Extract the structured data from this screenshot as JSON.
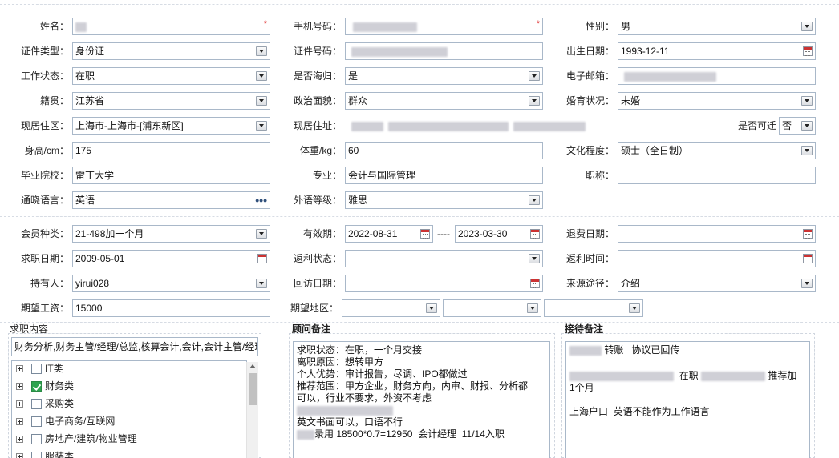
{
  "form": {
    "name_label": "姓名：",
    "phone_label": "手机号码：",
    "gender_label": "性别：",
    "gender_value": "男",
    "id_type_label": "证件类型：",
    "id_type_value": "身份证",
    "id_no_label": "证件号码：",
    "birth_label": "出生日期：",
    "birth_value": "1993-12-11",
    "work_status_label": "工作状态：",
    "work_status_value": "在职",
    "overseas_label": "是否海归：",
    "overseas_value": "是",
    "email_label": "电子邮箱：",
    "origin_label": "籍贯：",
    "origin_value": "江苏省",
    "politics_label": "政治面貌：",
    "politics_value": "群众",
    "marital_label": "婚育状况：",
    "marital_value": "未婚",
    "area_label": "现居住区：",
    "area_value": "上海市-上海市-[浦东新区]",
    "address_label": "现居住址：",
    "relocate_label": "是否可迁",
    "relocate_value": "否",
    "height_label": "身高/cm：",
    "height_value": "175",
    "weight_label": "体重/kg：",
    "weight_value": "60",
    "education_label": "文化程度：",
    "education_value": "硕士（全日制）",
    "school_label": "毕业院校：",
    "school_value": "雷丁大学",
    "major_label": "专业：",
    "major_value": "会计与国际管理",
    "title_label": "职称：",
    "language_label": "通晓语言：",
    "language_value": "英语",
    "language_more": "•••",
    "lang_level_label": "外语等级：",
    "lang_level_value": "雅思"
  },
  "member": {
    "type_label": "会员种类：",
    "type_value": "21-498加一个月",
    "valid_label": "有效期：",
    "valid_from": "2022-08-31",
    "valid_sep": "----",
    "valid_to": "2023-03-30",
    "refund_label": "退费日期：",
    "job_date_label": "求职日期：",
    "job_date_value": "2009-05-01",
    "rebate_status_label": "返利状态：",
    "rebate_time_label": "返利时间：",
    "holder_label": "持有人：",
    "holder_value": "yirui028",
    "callback_label": "回访日期：",
    "source_label": "来源途径：",
    "source_value": "介绍",
    "salary_label": "期望工资：",
    "salary_value": "15000",
    "region_label": "期望地区："
  },
  "job": {
    "title": "求职内容",
    "summary": "财务分析,财务主管/经理/总监,核算会计,会计,会计主管/经理",
    "tree": [
      {
        "label": "IT类",
        "checked": false
      },
      {
        "label": "财务类",
        "checked": true
      },
      {
        "label": "采购类",
        "checked": false
      },
      {
        "label": "电子商务/互联网",
        "checked": false
      },
      {
        "label": "房地产/建筑/物业管理",
        "checked": false
      },
      {
        "label": "服装类",
        "checked": false
      }
    ]
  },
  "advisor": {
    "title": "顾问备注",
    "l1": "求职状态：在职，一个月交接",
    "l2": "离职原因：想转甲方",
    "l3": "个人优势：审计报告，尽调、IPO都做过",
    "l4": "推荐范围：甲方企业，财务方向，内审、财报、分析都",
    "l5": "可以，行业不要求，外资不考虑",
    "l7": "英文书面可以，口语不行",
    "l8": "录用 18500*0.7=12950  会计经理  11/14入职"
  },
  "reception": {
    "title": "接待备注",
    "l1a": "转账",
    "l1b": "协议已回传",
    "l2a": "在职",
    "l2b": "推荐加",
    "l3": "1个月",
    "l4": "上海户口  英语不能作为工作语言"
  },
  "colors": {
    "border": "#a9b8c9",
    "required": "#d22",
    "checked": "#2ea44f"
  }
}
